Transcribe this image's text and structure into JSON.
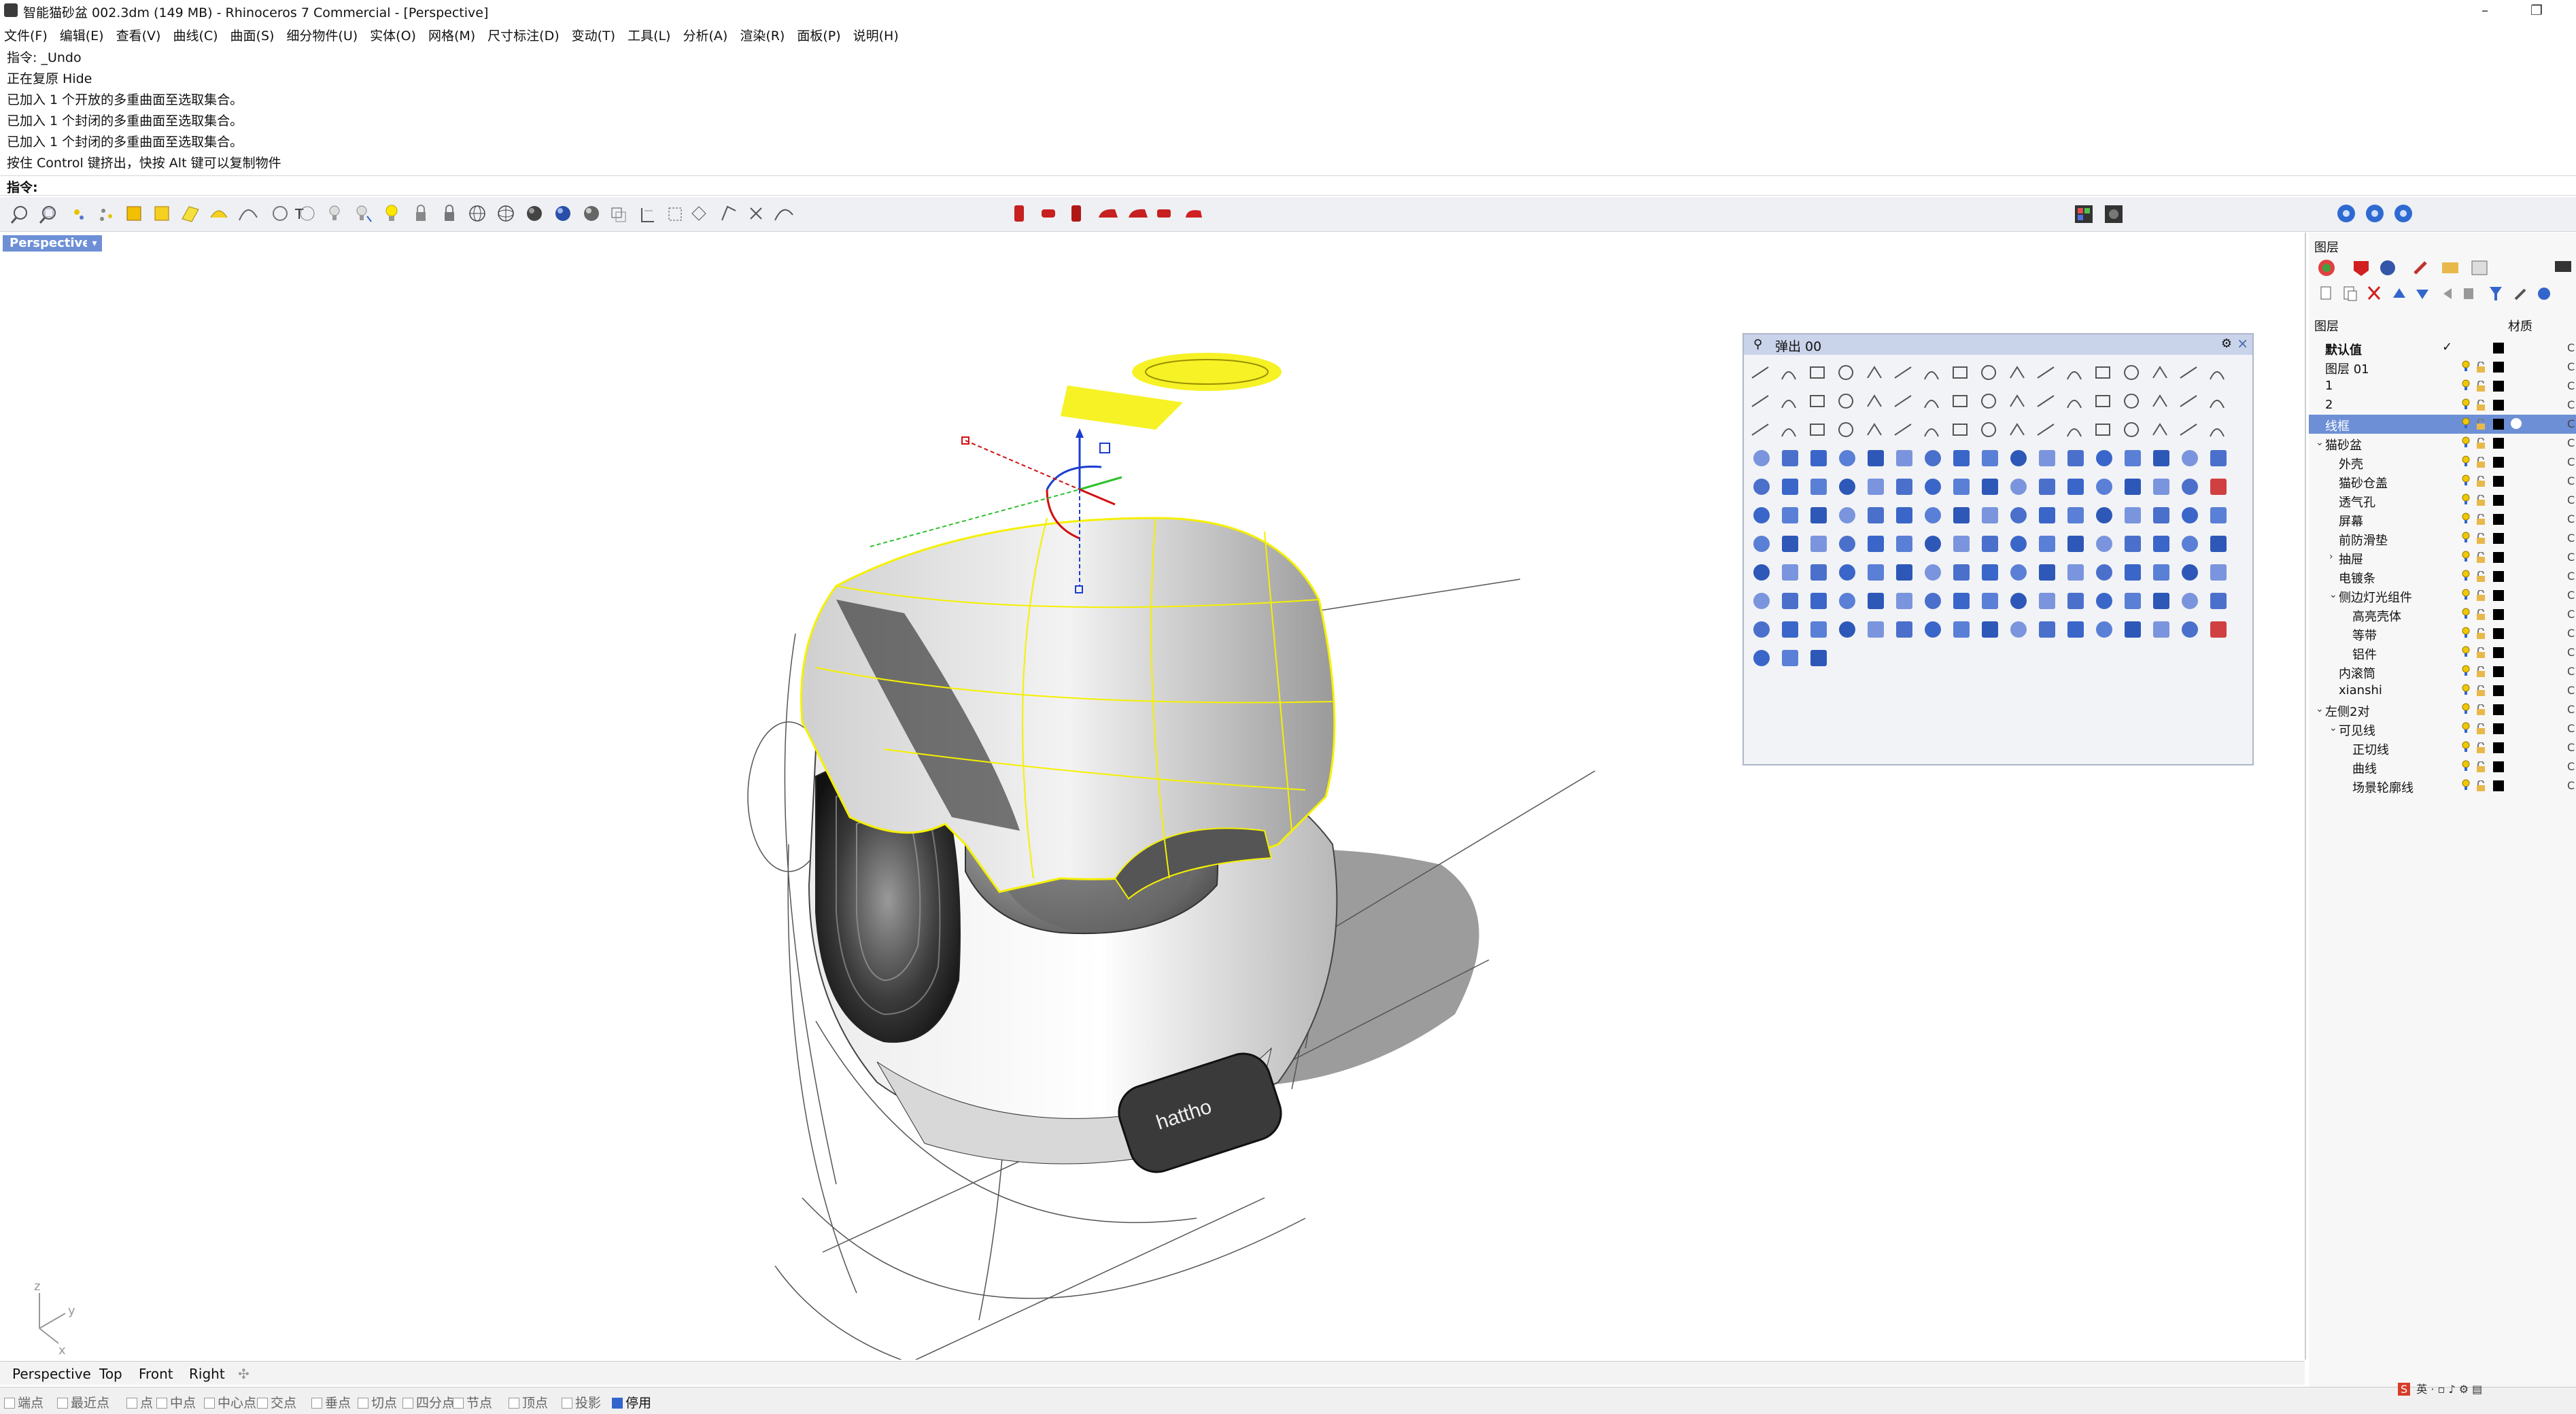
{
  "titlebar": {
    "title": "智能猫砂盆 002.3dm (149 MB) - Rhinoceros 7 Commercial - [Perspective]",
    "minimize": "–",
    "restore": "❐"
  },
  "menu": [
    "文件(F)",
    "编辑(E)",
    "查看(V)",
    "曲线(C)",
    "曲面(S)",
    "细分物件(U)",
    "实体(O)",
    "网格(M)",
    "尺寸标注(D)",
    "变动(T)",
    "工具(L)",
    "分析(A)",
    "渲染(R)",
    "面板(P)",
    "说明(H)"
  ],
  "command_history": [
    "指令: _Undo",
    "正在复原 Hide",
    "已加入 1 个开放的多重曲面至选取集合。",
    "已加入 1 个封闭的多重曲面至选取集合。",
    "已加入 1 个封闭的多重曲面至选取集合。",
    "按住 Control 键挤出，快按 Alt 键可以复制物件"
  ],
  "command_prompt": "指令:",
  "viewport": {
    "label": "Perspective",
    "dropdown": "▾",
    "logo_text": "hattho",
    "axis": {
      "z": "z",
      "y": "y",
      "x": "x"
    }
  },
  "popup": {
    "title": "弹出 00",
    "pin": "⚲",
    "gear": "⚙",
    "close": "×"
  },
  "right_panel": {
    "panel_title": "图层",
    "header_name": "图层",
    "header_material": "材质",
    "layers": [
      {
        "name": "默认值",
        "bold": true,
        "current": "✓",
        "indent": 0
      },
      {
        "name": "图层 01",
        "indent": 0
      },
      {
        "name": "1",
        "indent": 0
      },
      {
        "name": "2",
        "indent": 0
      },
      {
        "name": "线框",
        "indent": 0,
        "selected": true
      },
      {
        "name": "猫砂盆",
        "indent": 0,
        "expand": "⌄"
      },
      {
        "name": "外壳",
        "indent": 1
      },
      {
        "name": "猫砂仓盖",
        "indent": 1
      },
      {
        "name": "透气孔",
        "indent": 1
      },
      {
        "name": "屏幕",
        "indent": 1
      },
      {
        "name": "前防滑垫",
        "indent": 1
      },
      {
        "name": "抽屉",
        "indent": 1,
        "expand": "›"
      },
      {
        "name": "电镀条",
        "indent": 1
      },
      {
        "name": "侧边灯光组件",
        "indent": 1,
        "expand": "⌄"
      },
      {
        "name": "高亮壳体",
        "indent": 2
      },
      {
        "name": "等带",
        "indent": 2
      },
      {
        "name": "铝件",
        "indent": 2
      },
      {
        "name": "内滚筒",
        "indent": 1
      },
      {
        "name": "xianshi",
        "indent": 1
      },
      {
        "name": "左侧2对",
        "indent": 0,
        "expand": "⌄"
      },
      {
        "name": "可见线",
        "indent": 1,
        "expand": "⌄"
      },
      {
        "name": "正切线",
        "indent": 2
      },
      {
        "name": "曲线",
        "indent": 2
      },
      {
        "name": "场景轮廓线",
        "indent": 2
      }
    ]
  },
  "view_tabs": [
    "Perspective",
    "Top",
    "Front",
    "Right",
    "✣"
  ],
  "osnap": [
    {
      "label": "端点"
    },
    {
      "label": "最近点"
    },
    {
      "label": "点"
    },
    {
      "label": "中点"
    },
    {
      "label": "中心点"
    },
    {
      "label": "交点"
    },
    {
      "label": "垂点"
    },
    {
      "label": "切点"
    },
    {
      "label": "四分点"
    },
    {
      "label": "节点"
    },
    {
      "label": "顶点"
    },
    {
      "label": "投影"
    },
    {
      "label": "停用",
      "checked": true
    }
  ],
  "tray_text": "英 · ▫ ♪ ⚙ ▤",
  "colors": {
    "accent": "#6d8fd6",
    "selection_yellow": "#f5f000",
    "popup_header": "#c9d3ea",
    "toolbar_bg": "#eef0f4"
  }
}
